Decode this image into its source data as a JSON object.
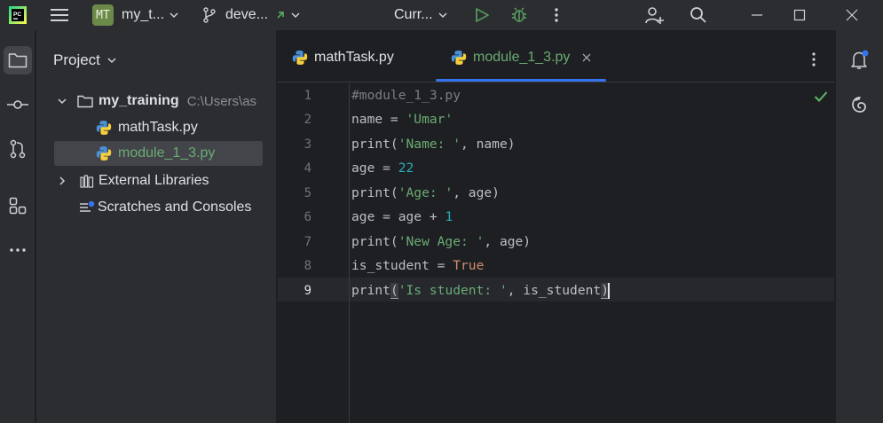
{
  "titlebar": {
    "app_badge": "PC",
    "project_badge": "MT",
    "project_name": "my_t...",
    "branch": "deve...",
    "run_config": "Curr..."
  },
  "project_panel": {
    "title": "Project",
    "root": {
      "name": "my_training",
      "path": "C:\\Users\\as"
    },
    "files": [
      "mathTask.py",
      "module_1_3.py"
    ],
    "external_libraries": "External Libraries",
    "scratches": "Scratches and Consoles"
  },
  "tabs": [
    {
      "label": "mathTask.py"
    },
    {
      "label": "module_1_3.py"
    }
  ],
  "editor": {
    "line_numbers": [
      "1",
      "2",
      "3",
      "4",
      "5",
      "6",
      "7",
      "8",
      "9"
    ],
    "current_line": 9,
    "lines": [
      "#module_1_3.py",
      "name = 'Umar'",
      "print('Name: ', name)",
      "age = 22",
      "print('Age: ', age)",
      "age = age + 1",
      "print('New Age: ', age)",
      "is_student = True",
      "print('Is student: ', is_student)"
    ]
  },
  "colors": {
    "accent": "#3574f0",
    "ok_green": "#5fb865",
    "run_green": "#57965c"
  }
}
